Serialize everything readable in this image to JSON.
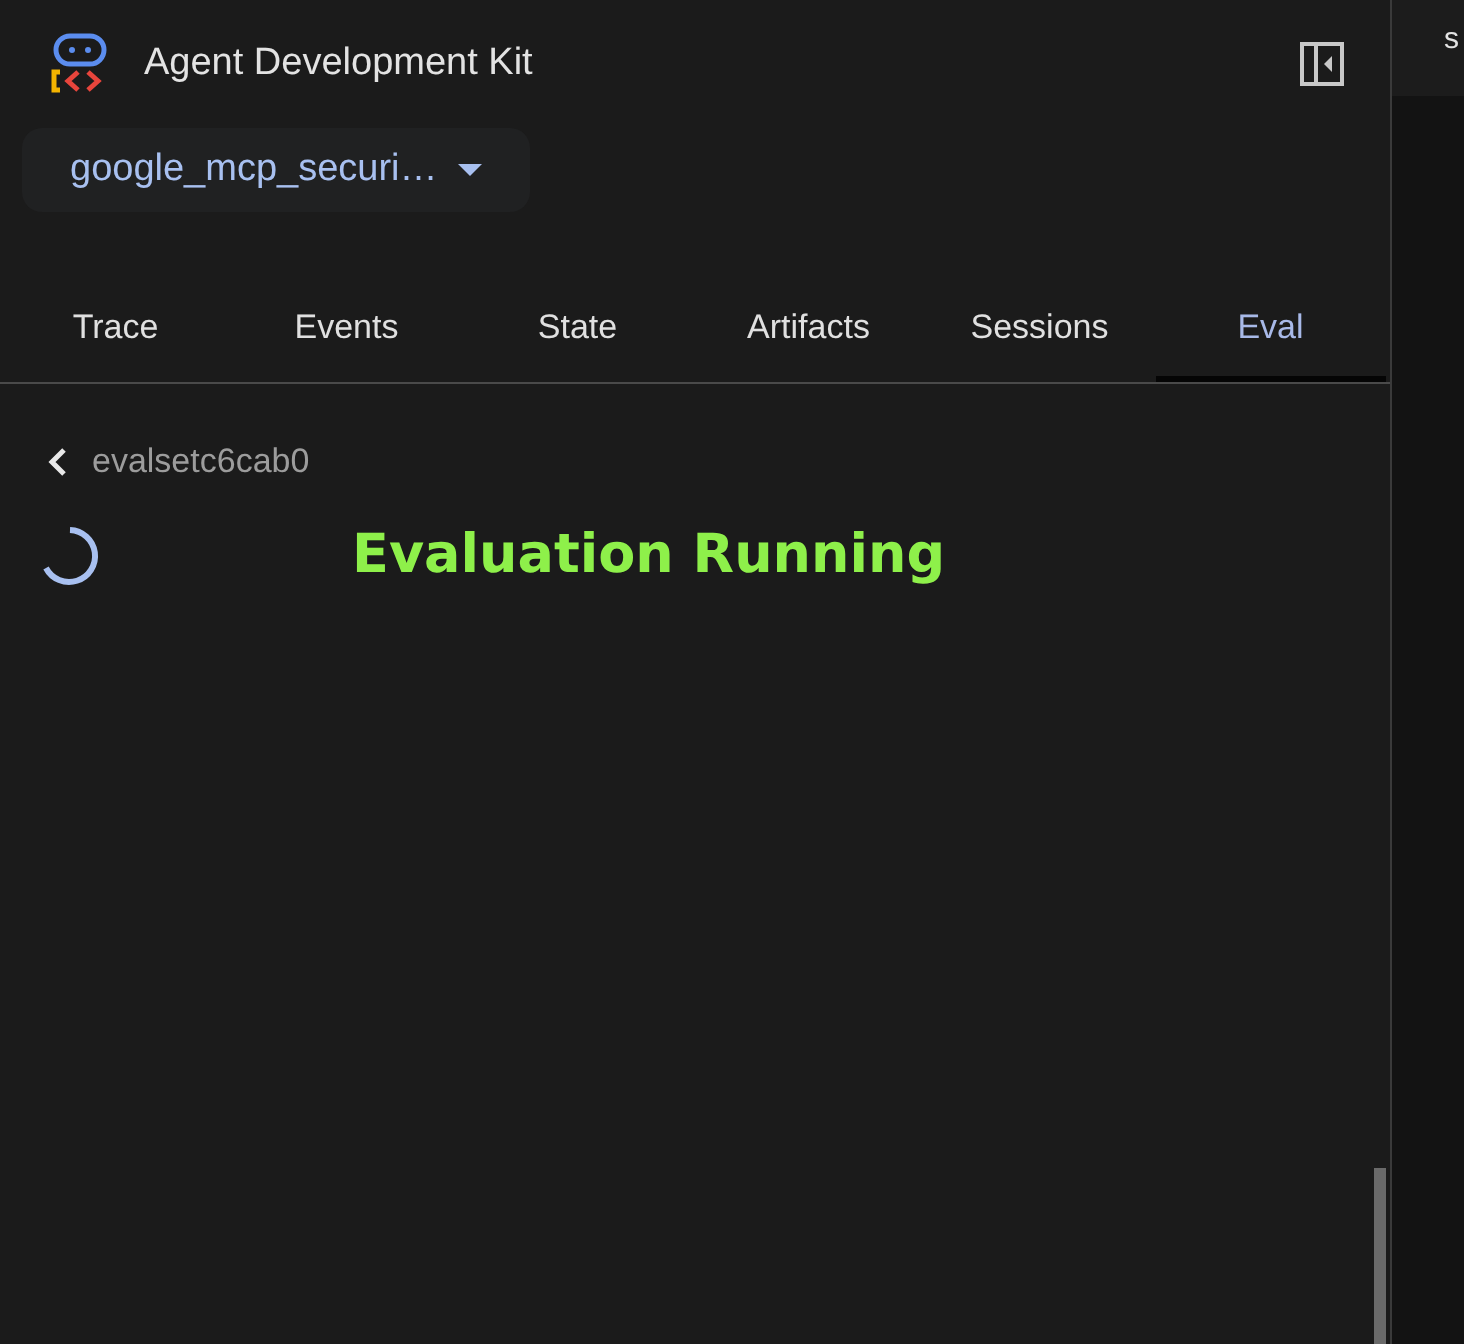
{
  "app": {
    "title": "Agent Development Kit"
  },
  "agent_selector": {
    "value": "google_mcp_securi…"
  },
  "tabs": [
    {
      "label": "Trace",
      "selected": false
    },
    {
      "label": "Events",
      "selected": false
    },
    {
      "label": "State",
      "selected": false
    },
    {
      "label": "Artifacts",
      "selected": false
    },
    {
      "label": "Sessions",
      "selected": false
    },
    {
      "label": "Eval",
      "selected": true
    }
  ],
  "eval": {
    "back_label": "evalsetc6cab0",
    "status": "Evaluation Running"
  },
  "right_panel": {
    "header_text": "s"
  }
}
